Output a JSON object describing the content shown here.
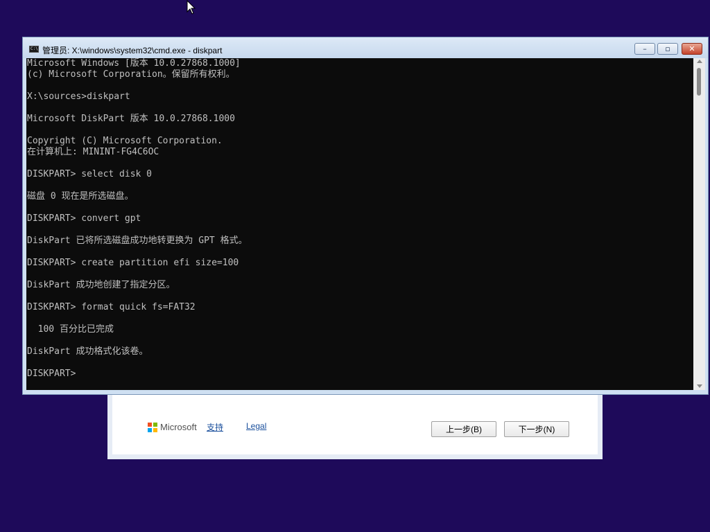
{
  "colors": {
    "desktop": "#1e0a5a",
    "console_bg": "#0c0c0c",
    "console_fg": "#c0c0c0",
    "ms_logo": [
      "#f25022",
      "#7fba00",
      "#00a4ef",
      "#ffb900"
    ]
  },
  "cmd": {
    "title": "管理员: X:\\windows\\system32\\cmd.exe - diskpart",
    "icon": "cmd-icon",
    "minimize_label": "–",
    "maximize_label": "▫",
    "close_label": "✕",
    "lines": [
      "Microsoft Windows [版本 10.0.27868.1000]",
      "(c) Microsoft Corporation。保留所有权利。",
      "",
      "X:\\sources>diskpart",
      "",
      "Microsoft DiskPart 版本 10.0.27868.1000",
      "",
      "Copyright (C) Microsoft Corporation.",
      "在计算机上: MININT-FG4C6OC",
      "",
      "DISKPART> select disk 0",
      "",
      "磁盘 0 现在是所选磁盘。",
      "",
      "DISKPART> convert gpt",
      "",
      "DiskPart 已将所选磁盘成功地转更换为 GPT 格式。",
      "",
      "DISKPART> create partition efi size=100",
      "",
      "DiskPart 成功地创建了指定分区。",
      "",
      "DISKPART> format quick fs=FAT32",
      "",
      "  100 百分比已完成",
      "",
      "DiskPart 成功格式化该卷。",
      "",
      "DISKPART>"
    ]
  },
  "setup": {
    "brand": "Microsoft",
    "support_link": "支持",
    "legal_link": "Legal",
    "back_button": "上一步(B)",
    "next_button": "下一步(N)"
  }
}
